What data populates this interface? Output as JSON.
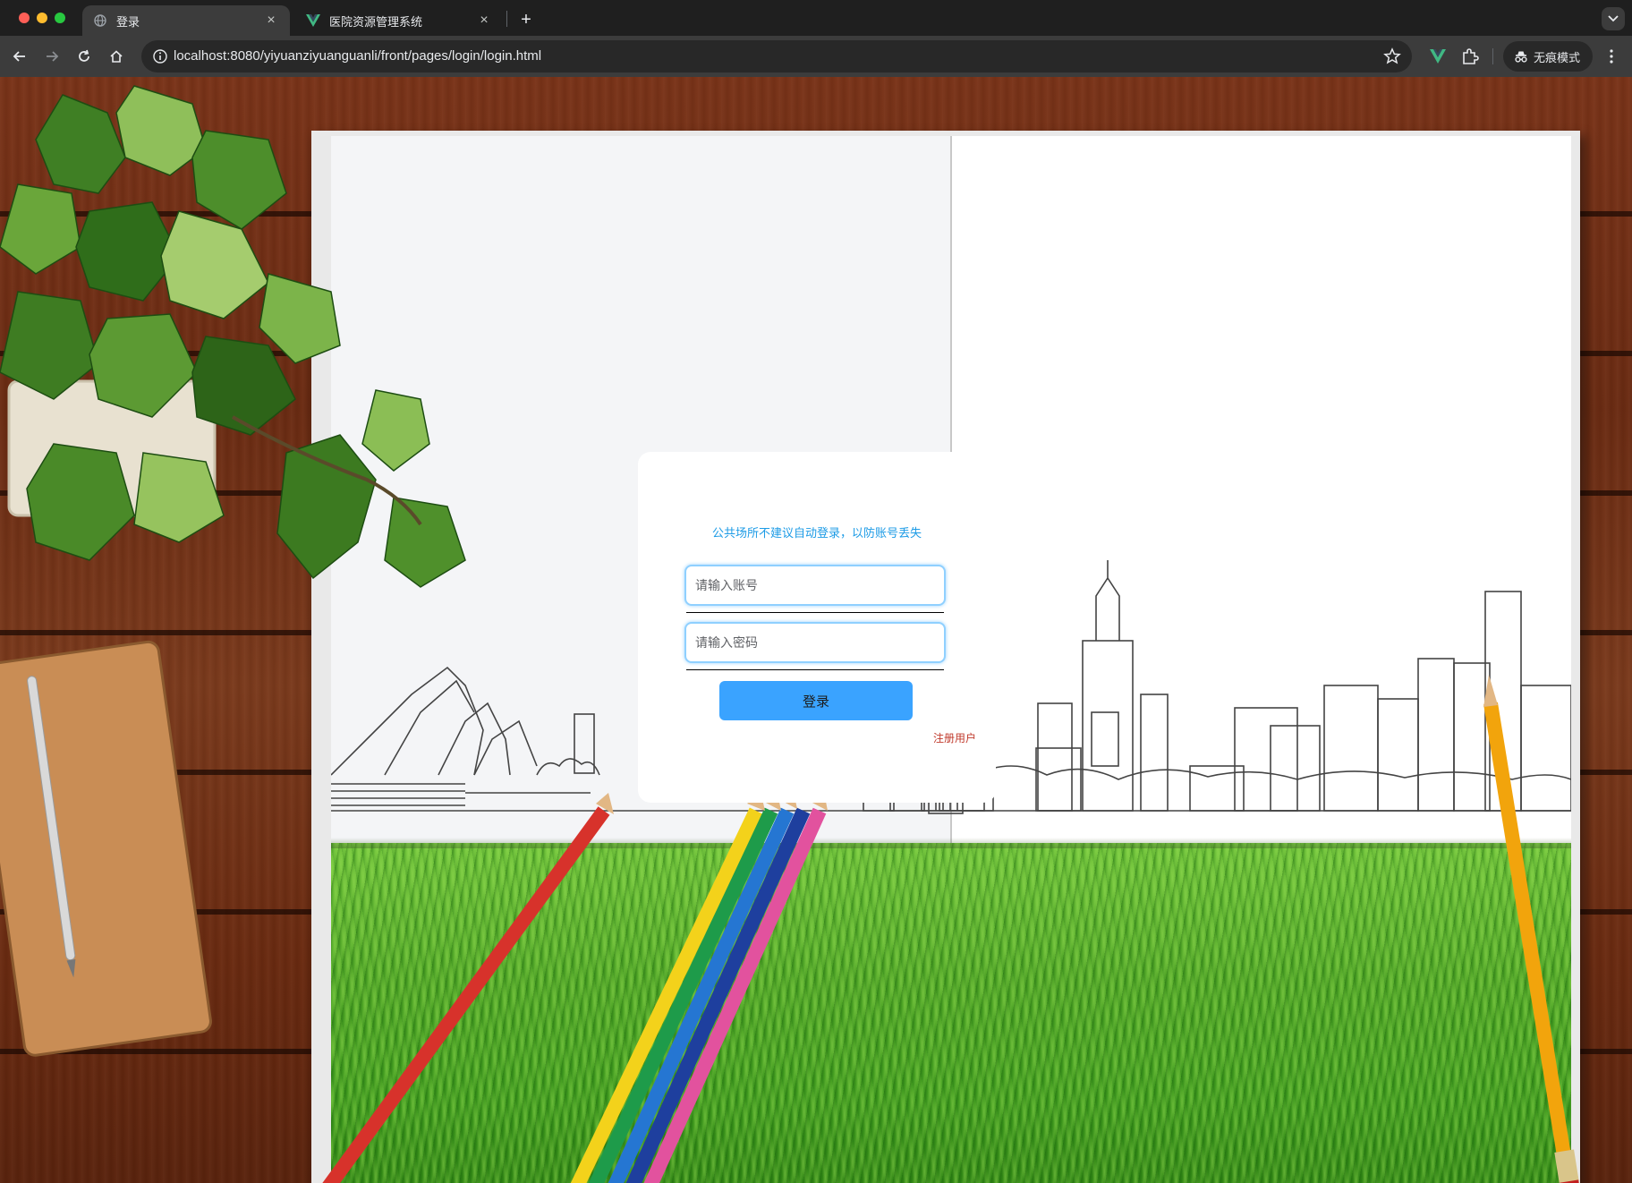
{
  "browser": {
    "tabs": [
      {
        "title": "登录",
        "active": true
      },
      {
        "title": "医院资源管理系统",
        "active": false
      }
    ],
    "url": "localhost:8080/yiyuanziyuanguanli/front/pages/login/login.html",
    "incognito_label": "无痕模式"
  },
  "login": {
    "tip": "公共场所不建议自动登录，以防账号丢失",
    "username_placeholder": "请输入账号",
    "password_placeholder": "请输入密码",
    "submit_label": "登录",
    "register_label": "注册用户"
  },
  "colors": {
    "tip": "#1c9be6",
    "button": "#3aa3ff",
    "register": "#c0392b",
    "input_border": "#8fd0ff"
  }
}
